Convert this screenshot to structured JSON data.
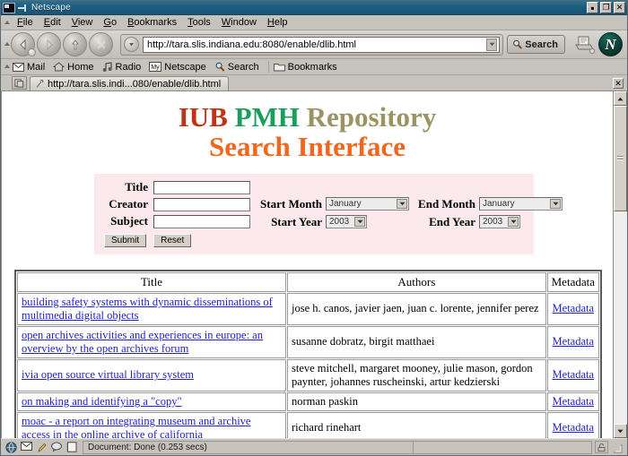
{
  "window": {
    "title": "Netscape",
    "app_icon": "netscape-icon",
    "buttons": {
      "minimize": "▪",
      "maximize": "❐",
      "close": "✕"
    }
  },
  "menubar": {
    "items": [
      {
        "label": "File",
        "accel": "F"
      },
      {
        "label": "Edit",
        "accel": "E"
      },
      {
        "label": "View",
        "accel": "V"
      },
      {
        "label": "Go",
        "accel": "G"
      },
      {
        "label": "Bookmarks",
        "accel": "B"
      },
      {
        "label": "Tools",
        "accel": "T"
      },
      {
        "label": "Window",
        "accel": "W"
      },
      {
        "label": "Help",
        "accel": "H"
      }
    ]
  },
  "navbar": {
    "back_label": "Back",
    "forward_label": "Forward",
    "reload_label": "Reload",
    "stop_label": "Stop",
    "url": "http://tara.slis.indiana.edu:8080/enable/dlib.html",
    "search_label": "Search",
    "print_label": "Print",
    "logo_letter": "N"
  },
  "personal_toolbar": {
    "items": [
      {
        "label": "Mail",
        "icon": "mail-icon"
      },
      {
        "label": "Home",
        "icon": "home-icon"
      },
      {
        "label": "Radio",
        "icon": "radio-icon"
      },
      {
        "label": "Netscape",
        "icon": "my-netscape-icon"
      },
      {
        "label": "Search",
        "icon": "search-icon"
      },
      {
        "label": "Bookmarks",
        "icon": "bookmarks-folder-icon"
      }
    ]
  },
  "tabbar": {
    "tabs": [
      {
        "label": "http://tara.slis.indi...080/enable/dlib.html"
      }
    ],
    "close_label": "✕"
  },
  "page": {
    "title_line1": [
      {
        "text": "IUB",
        "color": "#bf3317"
      },
      {
        "text": "PMH",
        "color": "#1a9e5c"
      },
      {
        "text": "Repository",
        "color": "#9b9462"
      }
    ],
    "title_line2": [
      {
        "text": "Search Interface",
        "color": "#f2671f"
      }
    ],
    "form": {
      "background": "#fbe9ee",
      "fields": [
        {
          "label": "Title",
          "value": "",
          "placeholder": ""
        },
        {
          "label": "Creator",
          "value": "",
          "placeholder": ""
        },
        {
          "label": "Subject",
          "value": "",
          "placeholder": ""
        }
      ],
      "submit_label": "Submit",
      "reset_label": "Reset",
      "date_selects": [
        {
          "label": "Start Month",
          "value": "January",
          "kind": "month"
        },
        {
          "label": "End Month",
          "value": "January",
          "kind": "month"
        },
        {
          "label": "Start Year",
          "value": "2003",
          "kind": "year"
        },
        {
          "label": "End Year",
          "value": "2003",
          "kind": "year"
        }
      ]
    },
    "results": {
      "headers": {
        "title": "Title",
        "authors": "Authors",
        "metadata": "Metadata"
      },
      "metadata_link_label": "Metadata",
      "rows": [
        {
          "title": "building safety systems with dynamic disseminations of multimedia digital objects",
          "authors": "jose h. canos, javier jaen, juan c. lorente, jennifer perez"
        },
        {
          "title": "open archives activities and experiences in europe: an overview by the open archives forum",
          "authors": "susanne dobratz, birgit matthaei"
        },
        {
          "title": "ivia open source virtual library system",
          "authors": "steve mitchell, margaret mooney, julie mason, gordon paynter, johannes ruscheinski, artur kedzierski"
        },
        {
          "title": "on making and identifying a \"copy\"",
          "authors": "norman paskin"
        },
        {
          "title": "moac - a report on integrating museum and archive access in the online archive of california",
          "authors": "richard rinehart"
        }
      ]
    }
  },
  "statusbar": {
    "text": "Document: Done (0.253 secs)",
    "icons": [
      "online-icon",
      "mail-icon",
      "composer-icon",
      "chat-icon",
      "addressbook-icon"
    ]
  },
  "colors": {
    "titlebar": "#1f5d80",
    "chrome": "#c6c3bd",
    "form_panel": "#fbe9ee",
    "link": "#2222cc"
  }
}
